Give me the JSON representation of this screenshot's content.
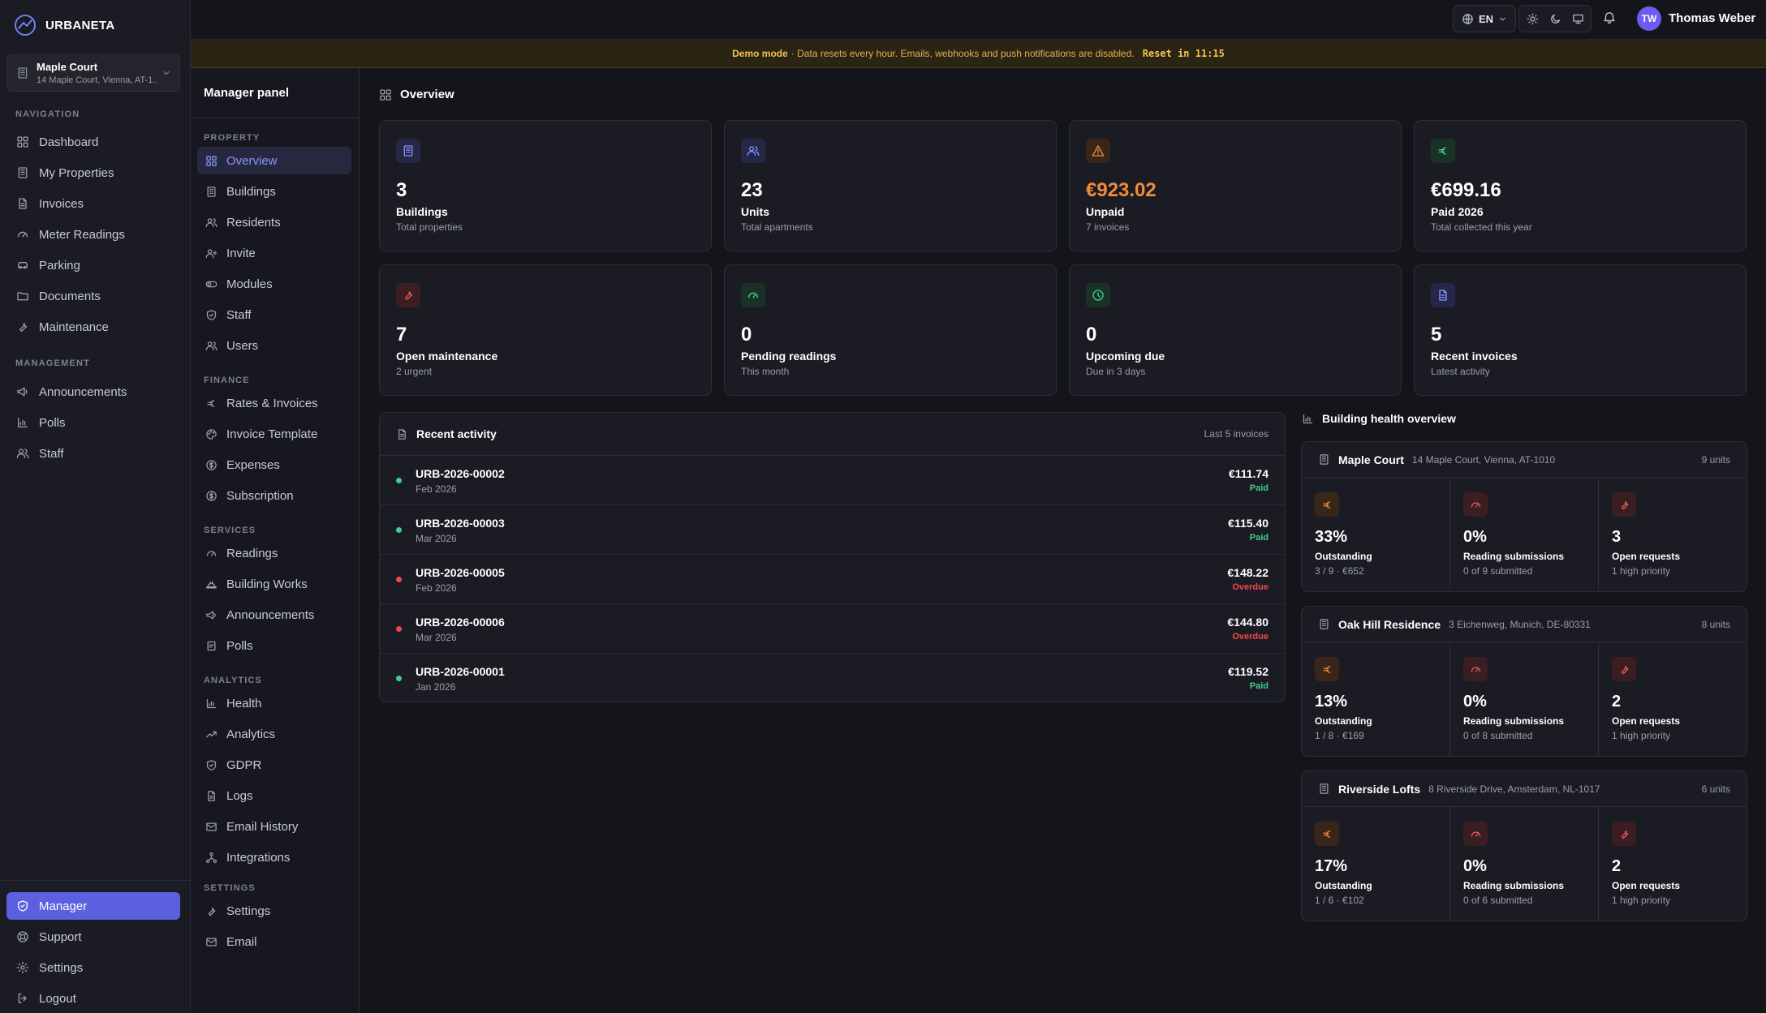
{
  "brand": {
    "name": "URBANETA"
  },
  "property_selector": {
    "name": "Maple Court",
    "address": "14 Maple Court, Vienna, AT-1..."
  },
  "sidebar": {
    "sections": {
      "navigation": "NAVIGATION",
      "management": "MANAGEMENT"
    },
    "navigation": [
      {
        "label": "Dashboard",
        "icon": "grid-icon"
      },
      {
        "label": "My Properties",
        "icon": "building-icon"
      },
      {
        "label": "Invoices",
        "icon": "file-text-icon"
      },
      {
        "label": "Meter Readings",
        "icon": "gauge-icon"
      },
      {
        "label": "Parking",
        "icon": "car-icon"
      },
      {
        "label": "Documents",
        "icon": "folder-icon"
      },
      {
        "label": "Maintenance",
        "icon": "wrench-icon"
      }
    ],
    "management": [
      {
        "label": "Announcements",
        "icon": "megaphone-icon"
      },
      {
        "label": "Polls",
        "icon": "bar-chart-icon"
      },
      {
        "label": "Staff",
        "icon": "users-icon"
      }
    ],
    "bottom": [
      {
        "label": "Manager",
        "icon": "shield-icon",
        "active": true
      },
      {
        "label": "Support",
        "icon": "lifebuoy-icon"
      },
      {
        "label": "Settings",
        "icon": "gear-icon"
      },
      {
        "label": "Logout",
        "icon": "logout-icon"
      }
    ]
  },
  "topbar": {
    "language": "EN",
    "user_initials": "TW",
    "user_name": "Thomas Weber"
  },
  "banner": {
    "label": "Demo mode",
    "message": "· Data resets every hour. Emails, webhooks and push notifications are disabled.",
    "reset": "Reset in 11:15"
  },
  "manager_panel": {
    "title": "Manager panel",
    "sections": {
      "property": "PROPERTY",
      "finance": "FINANCE",
      "services": "SERVICES",
      "analytics": "ANALYTICS",
      "settings": "SETTINGS"
    },
    "property": [
      {
        "label": "Overview",
        "icon": "grid-icon",
        "active": true
      },
      {
        "label": "Buildings",
        "icon": "building-icon"
      },
      {
        "label": "Residents",
        "icon": "users-icon"
      },
      {
        "label": "Invite",
        "icon": "user-plus-icon"
      },
      {
        "label": "Modules",
        "icon": "toggle-icon"
      },
      {
        "label": "Staff",
        "icon": "shield-icon"
      },
      {
        "label": "Users",
        "icon": "users-icon"
      }
    ],
    "finance": [
      {
        "label": "Rates & Invoices",
        "icon": "euro-icon"
      },
      {
        "label": "Invoice Template",
        "icon": "palette-icon"
      },
      {
        "label": "Expenses",
        "icon": "coin-icon"
      },
      {
        "label": "Subscription",
        "icon": "coin-icon"
      }
    ],
    "services": [
      {
        "label": "Readings",
        "icon": "gauge-icon"
      },
      {
        "label": "Building Works",
        "icon": "hard-hat-icon"
      },
      {
        "label": "Announcements",
        "icon": "megaphone-icon"
      },
      {
        "label": "Polls",
        "icon": "ballot-icon"
      }
    ],
    "analytics": [
      {
        "label": "Health",
        "icon": "bar-chart-icon"
      },
      {
        "label": "Analytics",
        "icon": "trending-icon"
      },
      {
        "label": "GDPR",
        "icon": "shield-icon"
      },
      {
        "label": "Logs",
        "icon": "file-text-icon"
      },
      {
        "label": "Email History",
        "icon": "mail-icon"
      },
      {
        "label": "Integrations",
        "icon": "network-icon"
      }
    ],
    "settings": [
      {
        "label": "Settings",
        "icon": "wrench-icon"
      },
      {
        "label": "Email",
        "icon": "mail-icon"
      }
    ]
  },
  "overview": {
    "title": "Overview",
    "cards": [
      {
        "value": "3",
        "label": "Buildings",
        "sub": "Total properties",
        "icon": "building-icon",
        "tone": "blue"
      },
      {
        "value": "23",
        "label": "Units",
        "sub": "Total apartments",
        "icon": "users-icon",
        "tone": "blue"
      },
      {
        "value": "€923.02",
        "label": "Unpaid",
        "sub": "7 invoices",
        "icon": "alert-triangle-icon",
        "tone": "orange",
        "value_color": "#f08a3c"
      },
      {
        "value": "€699.16",
        "label": "Paid 2026",
        "sub": "Total collected this year",
        "icon": "euro-icon",
        "tone": "green"
      },
      {
        "value": "7",
        "label": "Open maintenance",
        "sub": "2 urgent",
        "icon": "wrench-icon",
        "tone": "red"
      },
      {
        "value": "0",
        "label": "Pending readings",
        "sub": "This month",
        "icon": "gauge-icon",
        "tone": "green"
      },
      {
        "value": "0",
        "label": "Upcoming due",
        "sub": "Due in 3 days",
        "icon": "clock-icon",
        "tone": "green"
      },
      {
        "value": "5",
        "label": "Recent invoices",
        "sub": "Latest activity",
        "icon": "file-text-icon",
        "tone": "indigo"
      }
    ]
  },
  "activity": {
    "title": "Recent activity",
    "meta": "Last 5 invoices",
    "rows": [
      {
        "invoice": "URB-2026-00002",
        "date": "Feb 2026",
        "amount": "€111.74",
        "status": "Paid"
      },
      {
        "invoice": "URB-2026-00003",
        "date": "Mar 2026",
        "amount": "€115.40",
        "status": "Paid"
      },
      {
        "invoice": "URB-2026-00005",
        "date": "Feb 2026",
        "amount": "€148.22",
        "status": "Overdue"
      },
      {
        "invoice": "URB-2026-00006",
        "date": "Mar 2026",
        "amount": "€144.80",
        "status": "Overdue"
      },
      {
        "invoice": "URB-2026-00001",
        "date": "Jan 2026",
        "amount": "€119.52",
        "status": "Paid"
      }
    ]
  },
  "building_health": {
    "title": "Building health overview",
    "buildings": [
      {
        "name": "Maple Court",
        "address": "14 Maple Court, Vienna, AT-1010",
        "units": "9 units",
        "metrics": [
          {
            "value": "33%",
            "label": "Outstanding",
            "sub": "3 / 9 · €652",
            "icon": "euro-icon"
          },
          {
            "value": "0%",
            "label": "Reading submissions",
            "sub": "0 of 9 submitted",
            "icon": "gauge-icon"
          },
          {
            "value": "3",
            "label": "Open requests",
            "sub": "1 high priority",
            "icon": "wrench-icon"
          }
        ]
      },
      {
        "name": "Oak Hill Residence",
        "address": "3 Eichenweg, Munich, DE-80331",
        "units": "8 units",
        "metrics": [
          {
            "value": "13%",
            "label": "Outstanding",
            "sub": "1 / 8 · €169",
            "icon": "euro-icon"
          },
          {
            "value": "0%",
            "label": "Reading submissions",
            "sub": "0 of 8 submitted",
            "icon": "gauge-icon"
          },
          {
            "value": "2",
            "label": "Open requests",
            "sub": "1 high priority",
            "icon": "wrench-icon"
          }
        ]
      },
      {
        "name": "Riverside Lofts",
        "address": "8 Riverside Drive, Amsterdam, NL-1017",
        "units": "6 units",
        "metrics": [
          {
            "value": "17%",
            "label": "Outstanding",
            "sub": "1 / 6 · €102",
            "icon": "euro-icon"
          },
          {
            "value": "0%",
            "label": "Reading submissions",
            "sub": "0 of 6 submitted",
            "icon": "gauge-icon"
          },
          {
            "value": "2",
            "label": "Open requests",
            "sub": "1 high priority",
            "icon": "wrench-icon"
          }
        ]
      }
    ]
  }
}
